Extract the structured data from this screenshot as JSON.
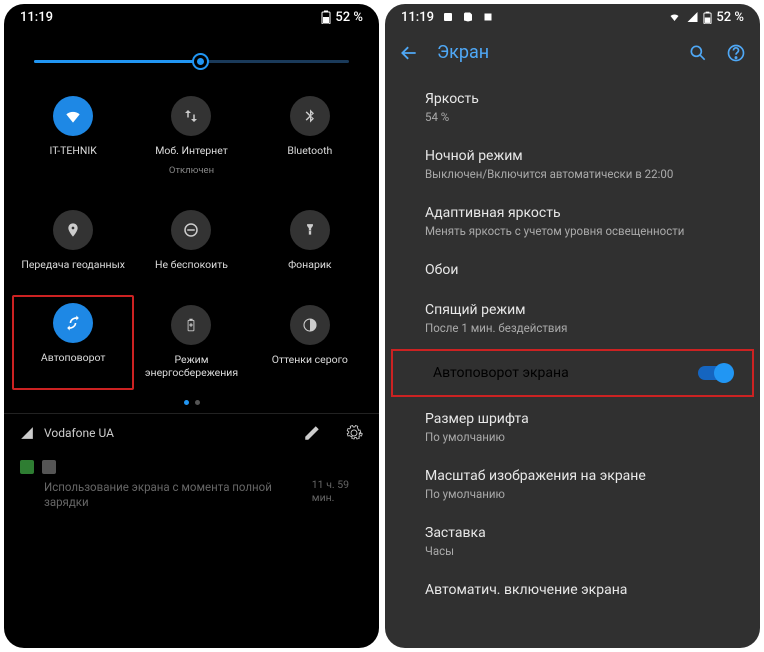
{
  "left": {
    "status": {
      "time": "11:19",
      "battery_pct": "52 %"
    },
    "brightness_pct": 52,
    "tiles": [
      {
        "id": "wifi",
        "label": "IT-TEHNIK",
        "active": true
      },
      {
        "id": "data",
        "label": "Моб. Интернет",
        "sub": "Отключен",
        "active": false
      },
      {
        "id": "bluetooth",
        "label": "Bluetooth",
        "active": false
      },
      {
        "id": "location",
        "label": "Передача геоданных",
        "active": false
      },
      {
        "id": "dnd",
        "label": "Не беспокоить",
        "active": false
      },
      {
        "id": "flashlight",
        "label": "Фонарик",
        "active": false
      },
      {
        "id": "autorotate",
        "label": "Автоповорот",
        "active": true,
        "highlight": true
      },
      {
        "id": "battery-saver",
        "label": "Режим энергосбережения",
        "active": false
      },
      {
        "id": "grayscale",
        "label": "Оттенки серого",
        "active": false
      }
    ],
    "carrier": "Vodafone UA",
    "notification": {
      "text": "Использование экрана с момента полной зарядки",
      "elapsed": "11 ч. 59 мин."
    }
  },
  "right": {
    "status": {
      "time": "11:19",
      "battery_pct": "52 %"
    },
    "appbar_title": "Экран",
    "items": [
      {
        "id": "brightness",
        "title": "Яркость",
        "sub": "54 %"
      },
      {
        "id": "night",
        "title": "Ночной режим",
        "sub": "Выключен/Включится автоматически в 22:00"
      },
      {
        "id": "adaptive",
        "title": "Адаптивная яркость",
        "sub": "Менять яркость с учетом уровня освещенности"
      },
      {
        "id": "wallpaper",
        "title": "Обои"
      },
      {
        "id": "sleep",
        "title": "Спящий режим",
        "sub": "После 1 мин. бездействия"
      },
      {
        "id": "autorotate",
        "title": "Автоповорот экрана",
        "toggle": true,
        "highlight": true
      },
      {
        "id": "font",
        "title": "Размер шрифта",
        "sub": "По умолчанию"
      },
      {
        "id": "displayscale",
        "title": "Масштаб изображения на экране",
        "sub": "По умолчанию"
      },
      {
        "id": "screensaver",
        "title": "Заставка",
        "sub": "Часы"
      },
      {
        "id": "autoon",
        "title": "Автоматич. включение экрана"
      }
    ]
  }
}
